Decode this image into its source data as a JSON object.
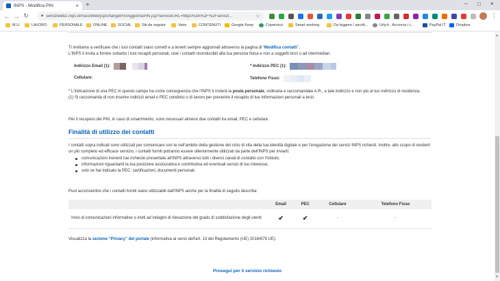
{
  "browser": {
    "tab_title": "INPS - Modifica PIN",
    "tab_close": "×",
    "new_tab": "+",
    "window_controls": [
      "–",
      "□",
      "×"
    ],
    "url": "serviziweb2.inps.it/PassiWeb/jsp/changePin/AggiornaPIN.jsp?serviceURL=https%3A%2F%2Fservizi...",
    "bookmarks": [
      "M.U.",
      "LAVORO",
      "PERSONALE",
      "ONLINE",
      "SOCIAL",
      "Siti da seguire",
      "Varie",
      "CONTENUTI",
      "Google Keep",
      "Copernico",
      "Smart working",
      "Da leggere / ascolt...",
      "Urly.it - Accorcia i t...",
      "PayPal IT",
      "Dropbox"
    ]
  },
  "form": {
    "intro_text": "Ti invitiamo a verificare che i tuoi contatti siano corretti e a tenerli sempre aggiornati attraverso la pagina di “",
    "intro_link": "Modifica contatti",
    "intro_end": "”.",
    "intro_line2": "L'INPS ti invita a fornire soltanto i tuoi recapiti personali, cioè i contatti riconducibili alla tua persona fisica e non a soggetti terzi o ad intermediari.",
    "email_label": "Indirizzo Email (1):",
    "pec_label": "* Indirizzo PEC (1):",
    "cell_label": "Cellulare:",
    "phone_label": "Telefono Fisso:",
    "note_a": "* L'indicazione di una PEC in questo campo ha come conseguenza che l'INPS ti invierà la ",
    "note_bold": "posta personale",
    "note_b": ", ordinaria e raccomandate A.R., a tale indirizzo e non più al tuo indirizzo di residenza.",
    "note_2": "(1) Si raccomanda di non inserire indirizzi email o PEC condivisi o di lavoro per prevenire il recapito di tue informazioni personali a terzi.",
    "recover_text": "Per il recupero del PIN, in caso di smarrimento, sono necessari almeno due contatti tra email, PEC e cellulare."
  },
  "purpose": {
    "heading": "Finalità di utilizzo dei contatti",
    "intro": "I contatti sopra indicati sono utilizzati per comunicare con te nell'ambito della gestione del ciclo di vita della tua identità digitale e per l'erogazione dei servizi INPS richiesti. Inoltre, allo scopo di renderti un più completo ed efficace servizio, i contatti forniti potranno essere ulteriormente utilizzati da parte dell'INPS per inviarti:",
    "bullets": [
      "comunicazioni inerenti tue richieste presentate all'INPS attraverso tutti i diversi canali di contatto con l'Istituto;",
      "informazioni riguardanti la tua posizione assicurativa e contributiva ed eventuali servizi di tuo interesse;",
      "solo se hai indicato la PEC: certificazioni, documenti personali."
    ],
    "consent_q": "Puoi acconsentire che i contatti forniti siano utilizzabili dall'INPS anche per la finalità di seguito descritta:",
    "table": {
      "headers": [
        "",
        "Email",
        "PEC",
        "Cellulare",
        "Telefono Fisso"
      ],
      "row_desc": "Invio di comunicazioni informative o inviti ad indagini di rilevazione del grado di soddisfazione degli utenti",
      "cells": [
        "✔",
        "✔",
        "-",
        "-"
      ]
    },
    "privacy_a": "Visualizza la ",
    "privacy_link": "sezione “Privacy” del portale",
    "privacy_b": " (informativa ai sensi dell'art. 13 del Regolamento (UE) 2016/679 UE).",
    "proceed": "Prosegui per il servizio richiesto"
  },
  "colors": {
    "accent": "#0a63b5",
    "masked_email": [
      "#b59b9b",
      "#7a6460",
      "#ffffff",
      "#e8e4ef",
      "#d9d2e2",
      "#9c7aa8"
    ],
    "masked_pec": [
      "#7a8fb5",
      "#8b98b8",
      "#a98da8",
      "#9aa6c8",
      "#c8d4e8",
      "#b7c9e0"
    ],
    "masked_phone": [
      "#f2f0f7",
      "#e8eef6",
      "#dde8f2",
      "#e9eef7"
    ]
  }
}
